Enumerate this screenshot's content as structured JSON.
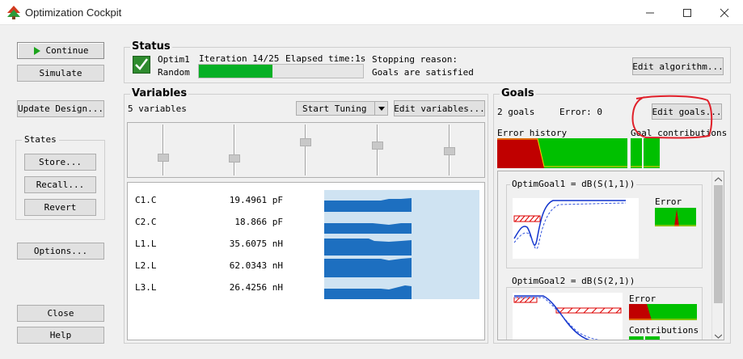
{
  "window": {
    "title": "Optimization Cockpit"
  },
  "left_panel": {
    "continue_label": "Continue",
    "simulate_label": "Simulate",
    "update_design_label": "Update Design...",
    "states_title": "States",
    "store_label": "Store...",
    "recall_label": "Recall...",
    "revert_label": "Revert",
    "options_label": "Options...",
    "close_label": "Close",
    "help_label": "Help"
  },
  "status": {
    "title": "Status",
    "optimizer": "Optim1",
    "algorithm": "Random",
    "iteration_text": "Iteration 14/25",
    "elapsed_text": "Elapsed time:1s",
    "progress": 0.45,
    "stopping_reason_label": "Stopping reason:",
    "stopping_reason_value": "Goals are satisfied",
    "edit_algorithm_label": "Edit algorithm..."
  },
  "variables": {
    "title": "Variables",
    "count_text": "5 variables",
    "start_tuning_label": "Start Tuning",
    "edit_variables_label": "Edit variables...",
    "items": [
      {
        "name": "C1.C",
        "value": "19.4961 pF"
      },
      {
        "name": "C2.C",
        "value": "18.866 pF"
      },
      {
        "name": "L1.L",
        "value": "35.6075 nH"
      },
      {
        "name": "L2.L",
        "value": "62.0343 nH"
      },
      {
        "name": "L3.L",
        "value": "26.4256 nH"
      }
    ]
  },
  "goals": {
    "title": "Goals",
    "count_text": "2 goals",
    "error_text": "Error:  0",
    "edit_goals_label": "Edit goals...",
    "error_history_label": "Error history",
    "goal_contributions_label": "Goal contributions",
    "goal_items": [
      {
        "title": "OptimGoal1 = dB(S(1,1))",
        "error_label": "Error"
      },
      {
        "title": "OptimGoal2 = dB(S(2,1))",
        "error_label": "Error",
        "contributions_label": "Contributions"
      }
    ]
  },
  "colors": {
    "progress": "#06b025",
    "error_red": "#c00000",
    "ok_green": "#00c000",
    "annotation": "#e0202a"
  }
}
